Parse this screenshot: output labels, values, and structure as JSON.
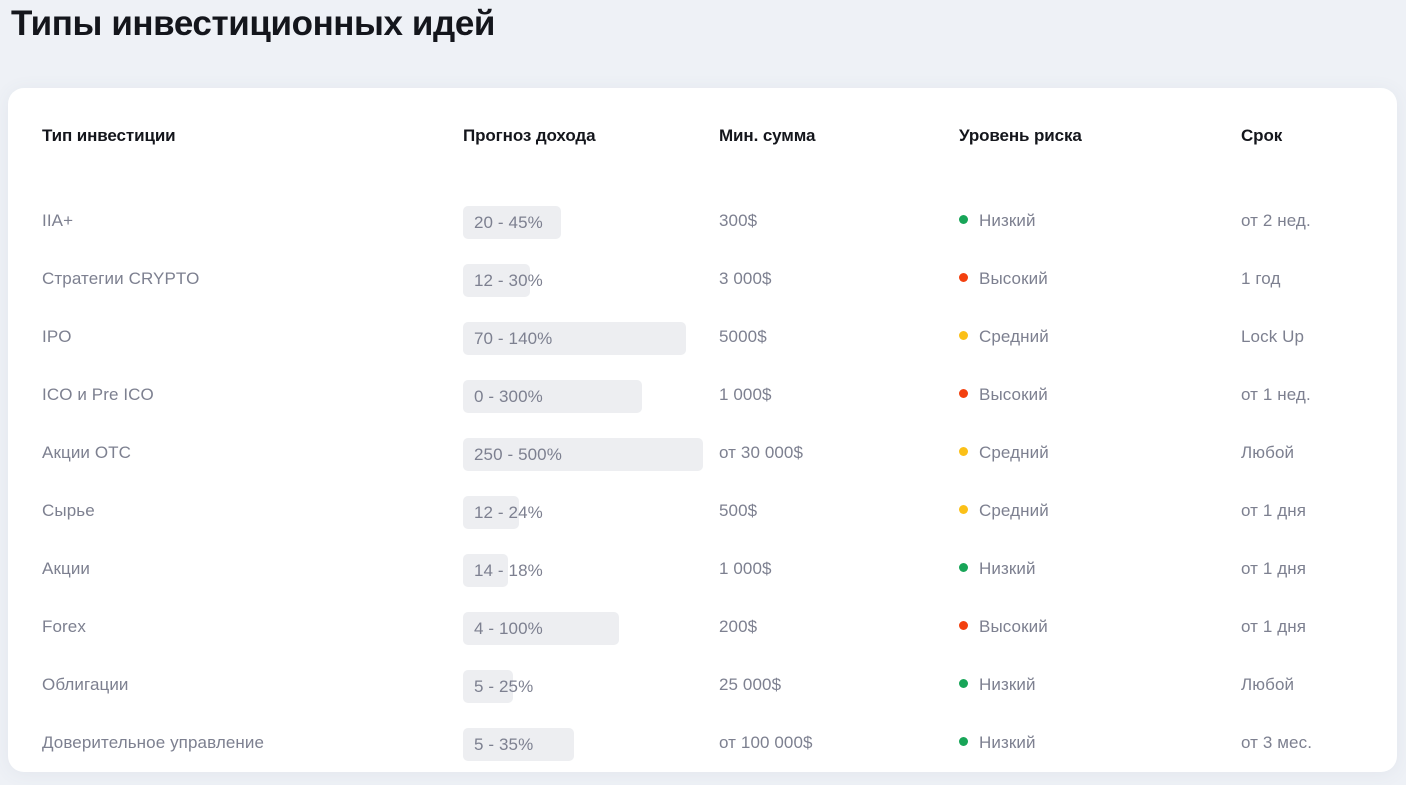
{
  "page": {
    "title": "Типы инвестиционных идей",
    "background_color": "#eef1f6",
    "card_color": "#ffffff"
  },
  "table": {
    "columns": [
      {
        "key": "type",
        "label": "Тип инвестиции"
      },
      {
        "key": "yield",
        "label": "Прогноз дохода"
      },
      {
        "key": "amount",
        "label": "Мин. сумма"
      },
      {
        "key": "risk",
        "label": "Уровень риска"
      },
      {
        "key": "term",
        "label": "Срок"
      }
    ],
    "risk_colors": {
      "low": "#18a558",
      "medium": "#fbc018",
      "high": "#f3400f"
    },
    "pill_color": "#edeef1",
    "rows": [
      {
        "type": "IIA+",
        "yield": "20 - 45%",
        "yield_pill_width": 98,
        "amount": "300$",
        "risk": "Низкий",
        "risk_level": "low",
        "term": "от 2 нед."
      },
      {
        "type": "Стратегии CRYPTO",
        "yield": "12 - 30%",
        "yield_pill_width": 67,
        "amount": "3 000$",
        "risk": "Высокий",
        "risk_level": "high",
        "term": "1 год"
      },
      {
        "type": "IPO",
        "yield": "70 - 140%",
        "yield_pill_width": 223,
        "amount": "5000$",
        "risk": "Средний",
        "risk_level": "medium",
        "term": "Lock Up"
      },
      {
        "type": "ICO и Pre ICO",
        "yield": "0 - 300%",
        "yield_pill_width": 179,
        "amount": "1 000$",
        "risk": "Высокий",
        "risk_level": "high",
        "term": "от 1 нед."
      },
      {
        "type": "Акции OTC",
        "yield": "250 - 500%",
        "yield_pill_width": 240,
        "amount": "от 30 000$",
        "risk": "Средний",
        "risk_level": "medium",
        "term": "Любой"
      },
      {
        "type": "Сырье",
        "yield": "12 - 24%",
        "yield_pill_width": 56,
        "amount": "500$",
        "risk": "Средний",
        "risk_level": "medium",
        "term": "от 1 дня"
      },
      {
        "type": "Акции",
        "yield": "14 - 18%",
        "yield_pill_width": 45,
        "amount": "1 000$",
        "risk": "Низкий",
        "risk_level": "low",
        "term": "от 1 дня"
      },
      {
        "type": "Forex",
        "yield": "4 - 100%",
        "yield_pill_width": 156,
        "amount": "200$",
        "risk": "Высокий",
        "risk_level": "high",
        "term": "от 1 дня"
      },
      {
        "type": "Облигации",
        "yield": "5 - 25%",
        "yield_pill_width": 50,
        "amount": "25 000$",
        "risk": "Низкий",
        "risk_level": "low",
        "term": "Любой"
      },
      {
        "type": "Доверительное управление",
        "yield": "5 - 35%",
        "yield_pill_width": 111,
        "amount": "от 100 000$",
        "risk": "Низкий",
        "risk_level": "low",
        "term": "от 3 мес."
      }
    ]
  }
}
